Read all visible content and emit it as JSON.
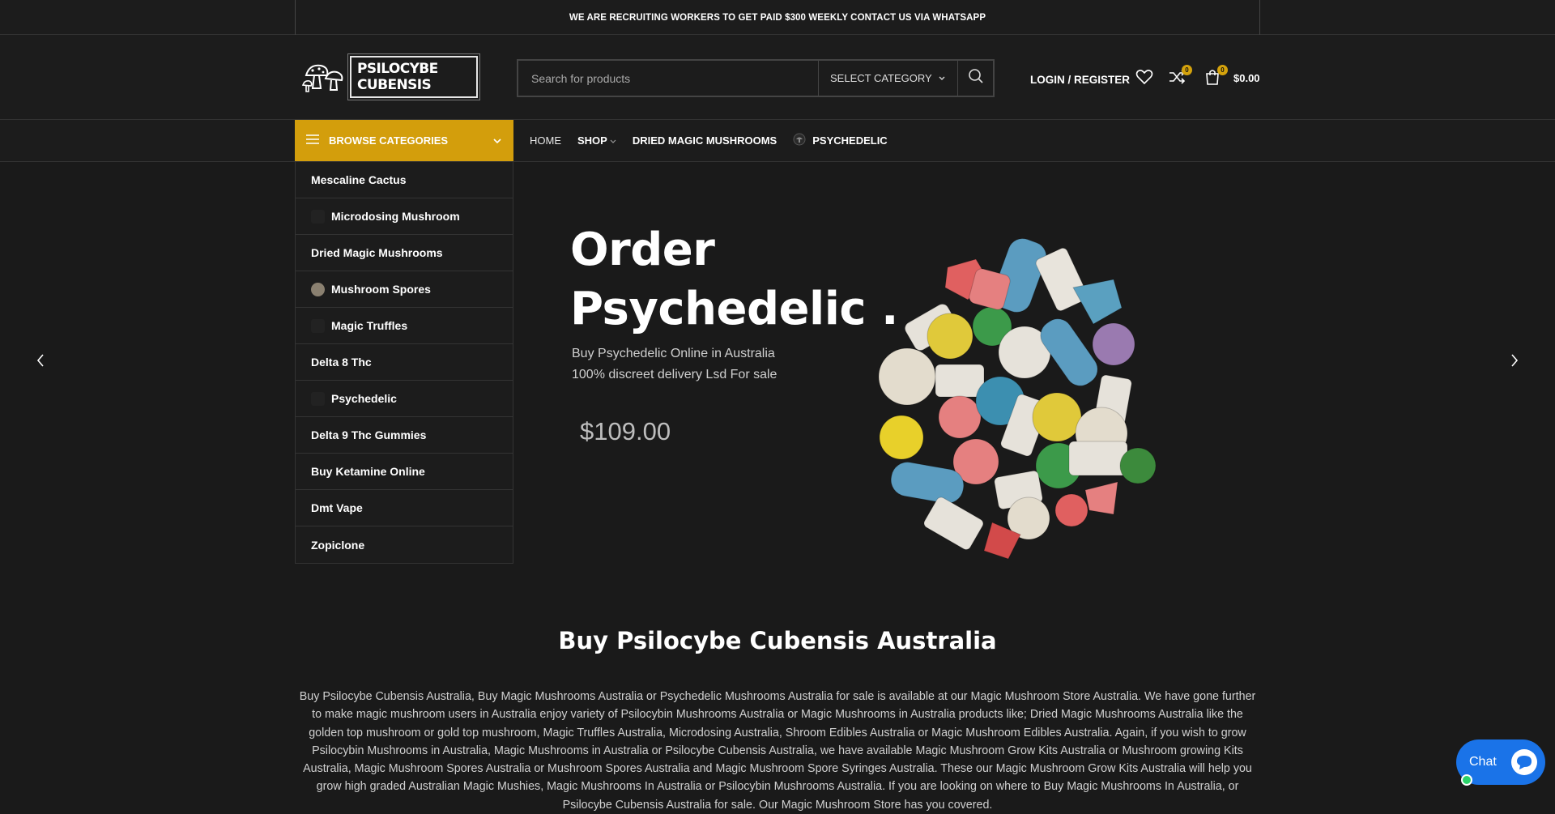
{
  "topbar": {
    "announcement": "WE ARE RECRUITING WORKERS TO GET PAID $300 WEEKLY CONTACT US VIA WHATSAPP"
  },
  "header": {
    "logo_text": "PSILOCYBE CUBENSIS",
    "search_placeholder": "Search for products",
    "category_select": "SELECT CATEGORY",
    "login_label": "LOGIN / REGISTER",
    "compare_count": "0",
    "cart_count": "0",
    "cart_total": "$0.00"
  },
  "nav": {
    "browse_label": "BROWSE CATEGORIES",
    "items": [
      "HOME",
      "SHOP",
      "DRIED MAGIC MUSHROOMS",
      "PSYCHEDELIC"
    ]
  },
  "categories": [
    "Mescaline Cactus",
    "Microdosing Mushroom",
    "Dried Magic Mushrooms",
    "Mushroom Spores",
    "Magic Truffles",
    "Delta 8 Thc",
    "Psychedelic",
    "Delta 9 Thc Gummies",
    "Buy Ketamine Online",
    "Dmt Vape",
    "Zopiclone"
  ],
  "hero": {
    "title_line1": "Order",
    "title_line2": "Psychedelic .",
    "subtitle_line1": "Buy Psychedelic Online in Australia",
    "subtitle_line2": "100% discreet delivery Lsd For sale",
    "price": "$109.00"
  },
  "section": {
    "title": "Buy Psilocybe Cubensis Australia",
    "body": "Buy Psilocybe Cubensis Australia, Buy Magic Mushrooms Australia or Psychedelic Mushrooms Australia for sale is available at our Magic Mushroom Store Australia. We have gone further to make magic mushroom users in Australia enjoy variety of Psilocybin Mushrooms Australia or Magic Mushrooms in Australia products like; Dried Magic Mushrooms Australia like the golden top mushroom or gold top mushroom, Magic Truffles Australia, Microdosing Australia, Shroom Edibles Australia or Magic Mushroom Edibles Australia. Again, if you wish to grow Psilocybin Mushrooms in Australia, Magic Mushrooms in Australia or Psilocybe Cubensis Australia, we have available Magic Mushroom Grow Kits Australia or Mushroom growing Kits Australia, Magic Mushroom Spores Australia or Mushroom Spores Australia and Magic Mushroom Spore Syringes Australia. These our Magic Mushroom Grow Kits Australia will help you grow high graded Australian Magic Mushies, Magic Mushrooms In Australia or Psilocybin Mushrooms Australia. If you are looking on where to Buy Magic Mushrooms In Australia, or Psilocybe Cubensis Australia for sale. Our Magic Mushroom Store has you covered."
  },
  "chat": {
    "label": "Chat"
  },
  "colors": {
    "accent": "#d39e0c",
    "background": "#1a1a1a",
    "chat": "#1a73e8"
  }
}
